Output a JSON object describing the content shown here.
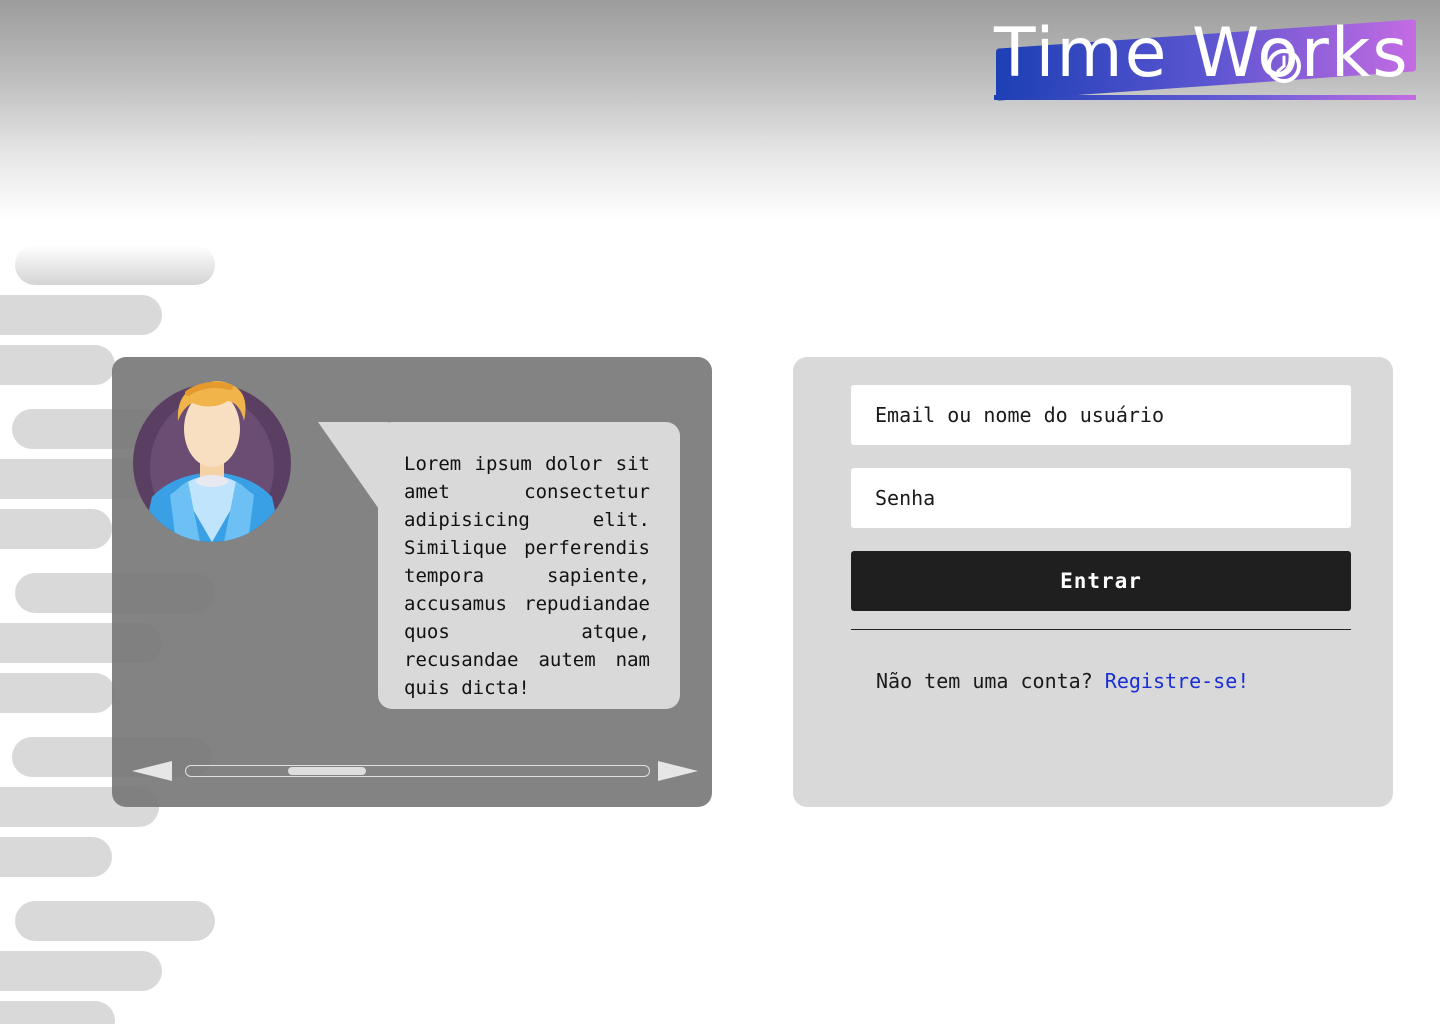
{
  "logo": {
    "text": "Time Works"
  },
  "testimonial": {
    "quote": "Lorem ipsum dolor sit amet consectetur adipisicing elit. Similique perferendis tempora sapiente, accusamus repudiandae quos atque, recusandae autem nam quis dicta!"
  },
  "login": {
    "email_placeholder": "Email ou nome do usuário",
    "password_placeholder": "Senha",
    "submit_label": "Entrar",
    "register_prompt": "Não tem uma conta?",
    "register_link": "Registre-se!"
  },
  "colors": {
    "logo_gradient_start": "#1d3fb5",
    "logo_gradient_end": "#c46be3",
    "button_bg": "#1f1f1f",
    "link": "#1a2ed6",
    "panel_bg": "#d9d9d9"
  },
  "icons": {
    "avatar": "user-avatar-icon",
    "prev": "arrow-left-icon",
    "next": "arrow-right-icon",
    "clock": "clock-icon"
  }
}
